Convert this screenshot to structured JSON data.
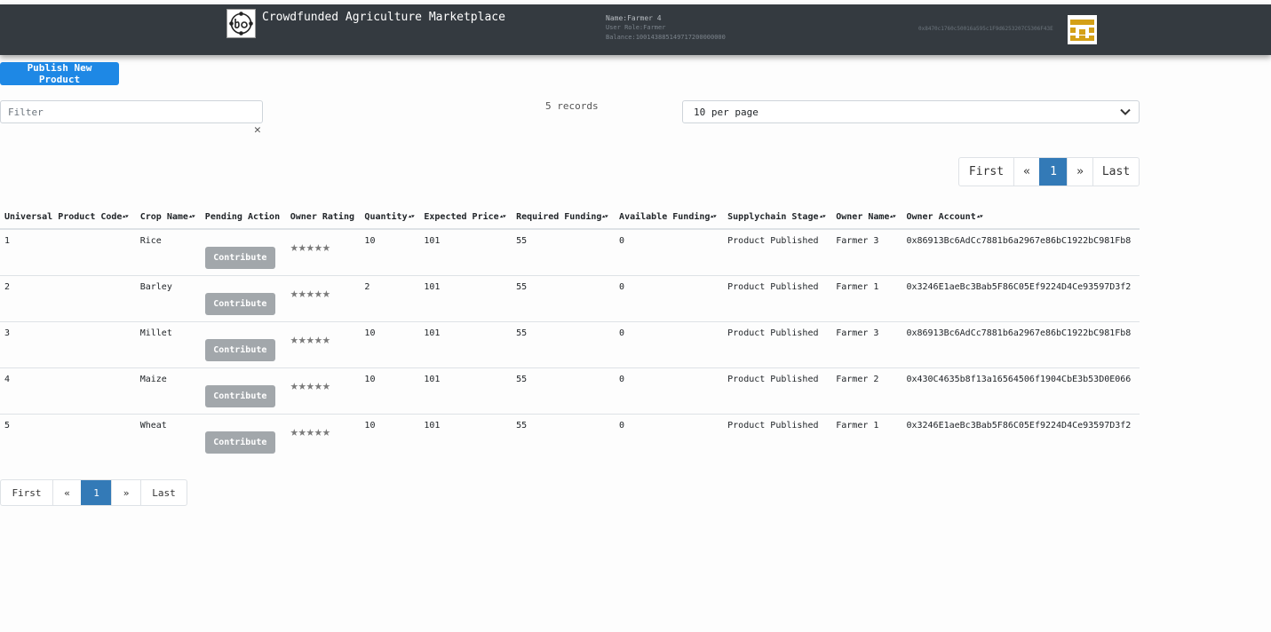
{
  "header": {
    "title": "Crowdfunded Agriculture Marketplace",
    "user_name": "Name:Farmer 4",
    "user_role": "User Role:Farmer",
    "balance": "Balance:100143885149717200000000",
    "account": "0x8470c1760c50016a595c1F9d6253207C5306F43E"
  },
  "actions": {
    "publish_label": "Publish New Product"
  },
  "filter": {
    "placeholder": "Filter",
    "clear_icon": "close-icon"
  },
  "records": "5 records",
  "per_page": "10 per page",
  "pagination": {
    "first": "First",
    "prev": "«",
    "current": "1",
    "next": "»",
    "last": "Last"
  },
  "table": {
    "columns": [
      {
        "label": "Universal Product Code",
        "sortable": true
      },
      {
        "label": "Crop Name",
        "sortable": true
      },
      {
        "label": "Pending Action",
        "sortable": false
      },
      {
        "label": "Owner Rating",
        "sortable": false
      },
      {
        "label": "Quantity",
        "sortable": true
      },
      {
        "label": "Expected Price",
        "sortable": true
      },
      {
        "label": "Required Funding",
        "sortable": true
      },
      {
        "label": "Available Funding",
        "sortable": true
      },
      {
        "label": "Supplychain Stage",
        "sortable": true
      },
      {
        "label": "Owner Name",
        "sortable": true
      },
      {
        "label": "Owner Account",
        "sortable": true
      }
    ],
    "action_label": "Contribute",
    "rating_stars": "★★★★★",
    "rows": [
      {
        "upc": "1",
        "crop": "Rice",
        "quantity": "10",
        "price": "101",
        "required": "55",
        "available": "0",
        "stage": "Product Published",
        "owner": "Farmer 3",
        "account": "0x86913Bc6AdCc7881b6a2967e86bC1922bC981Fb8"
      },
      {
        "upc": "2",
        "crop": "Barley",
        "quantity": "2",
        "price": "101",
        "required": "55",
        "available": "0",
        "stage": "Product Published",
        "owner": "Farmer 1",
        "account": "0x3246E1aeBc3Bab5F86C05Ef9224D4Ce93597D3f2"
      },
      {
        "upc": "3",
        "crop": "Millet",
        "quantity": "10",
        "price": "101",
        "required": "55",
        "available": "0",
        "stage": "Product Published",
        "owner": "Farmer 3",
        "account": "0x86913Bc6AdCc7881b6a2967e86bC1922bC981Fb8"
      },
      {
        "upc": "4",
        "crop": "Maize",
        "quantity": "10",
        "price": "101",
        "required": "55",
        "available": "0",
        "stage": "Product Published",
        "owner": "Farmer 2",
        "account": "0x430C4635b8f13a16564506f1904CbE3b53D0E066"
      },
      {
        "upc": "5",
        "crop": "Wheat",
        "quantity": "10",
        "price": "101",
        "required": "55",
        "available": "0",
        "stage": "Product Published",
        "owner": "Farmer 1",
        "account": "0x3246E1aeBc3Bab5F86C05Ef9224D4Ce93597D3f2"
      }
    ]
  }
}
